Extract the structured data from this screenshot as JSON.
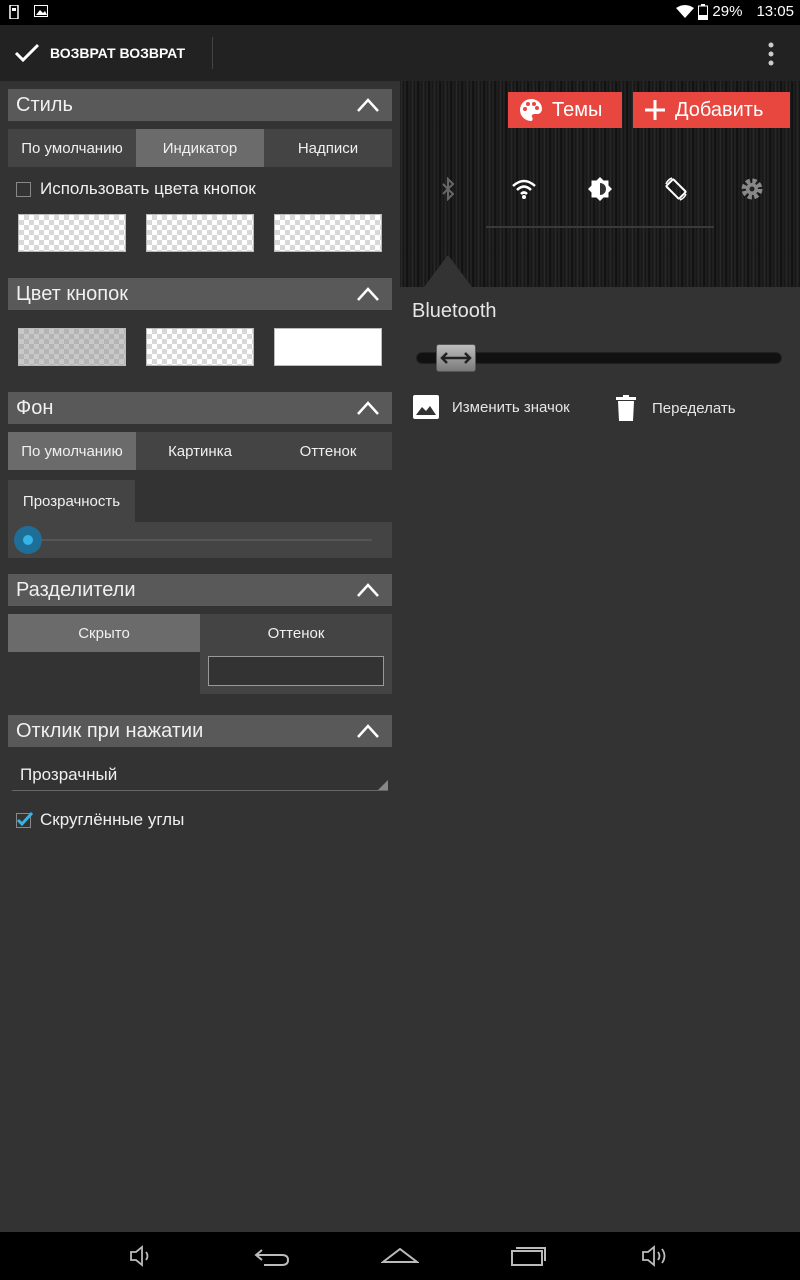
{
  "status_bar": {
    "battery": "29%",
    "time": "13:05"
  },
  "action_bar": {
    "done_label": "ВОЗВРАТ ВОЗВРАТ"
  },
  "style_section": {
    "title": "Стиль",
    "tabs": [
      "По умолчанию",
      "Индикатор",
      "Надписи"
    ],
    "selected_tab": 1,
    "checkbox_label": "Использовать цвета кнопок",
    "checkbox_checked": false
  },
  "button_color_section": {
    "title": "Цвет кнопок"
  },
  "background_section": {
    "title": "Фон",
    "tabs": [
      "По умолчанию",
      "Картинка",
      "Оттенок"
    ],
    "selected_tab": 0,
    "transparency_label": "Прозрачность",
    "transparency_value": 0
  },
  "dividers_section": {
    "title": "Разделители",
    "hidden_label": "Скрыто",
    "tint_label": "Оттенок"
  },
  "touch_feedback_section": {
    "title": "Отклик при нажатии",
    "dropdown_value": "Прозрачный",
    "rounded_label": "Скруглённые углы",
    "rounded_checked": true
  },
  "right_panel": {
    "themes_button": "Темы",
    "add_button": "Добавить",
    "selected_item_label": "Bluetooth",
    "change_icon_label": "Изменить значок",
    "remake_label": "Переделать"
  },
  "colors": {
    "accent": "#e8473f",
    "slider_blue": "#33b5e5"
  }
}
